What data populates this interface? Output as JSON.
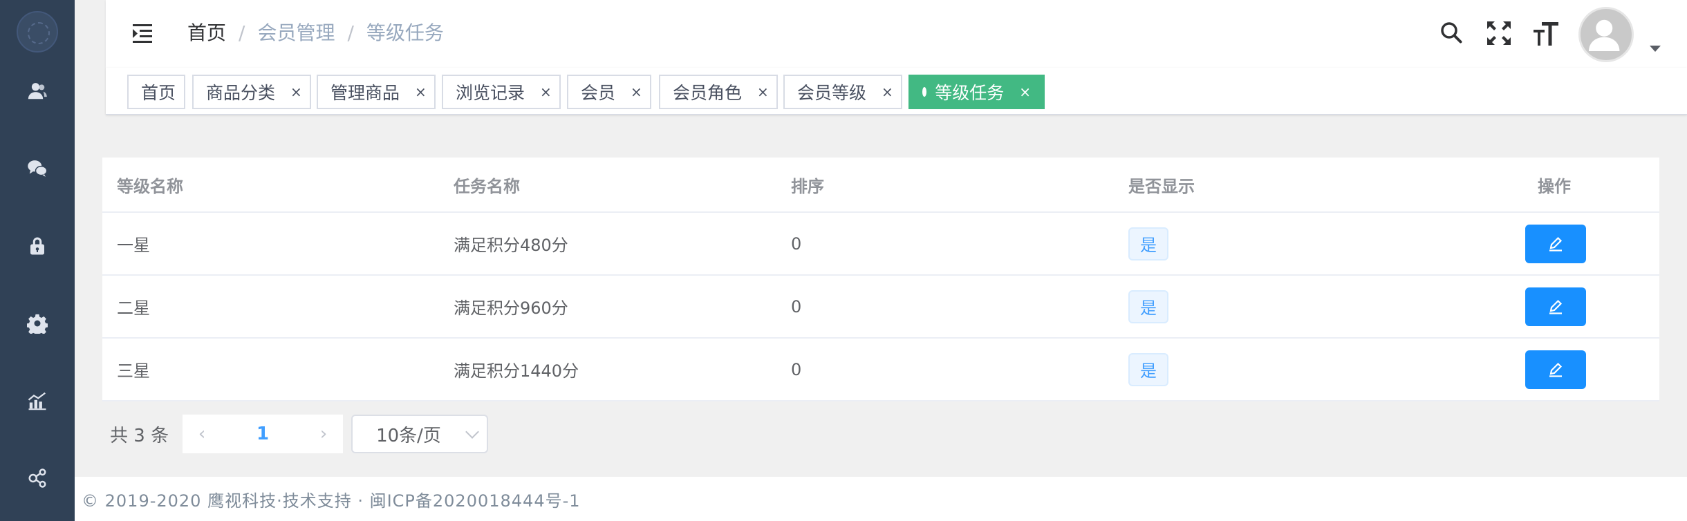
{
  "sidebar": {
    "items": [
      {
        "icon": "users-icon"
      },
      {
        "icon": "wechat-icon"
      },
      {
        "icon": "lock-icon"
      },
      {
        "icon": "gear-icon"
      },
      {
        "icon": "chart-icon"
      },
      {
        "icon": "share-icon"
      }
    ]
  },
  "breadcrumb": [
    "首页",
    "会员管理",
    "等级任务"
  ],
  "breadcrumb_separator": "/",
  "tags": [
    {
      "label": "首页",
      "closable": false
    },
    {
      "label": "商品分类",
      "closable": true
    },
    {
      "label": "管理商品",
      "closable": true
    },
    {
      "label": "浏览记录",
      "closable": true
    },
    {
      "label": "会员",
      "closable": true
    },
    {
      "label": "会员角色",
      "closable": true
    },
    {
      "label": "会员等级",
      "closable": true
    },
    {
      "label": "等级任务",
      "closable": true,
      "active": true
    }
  ],
  "tag_close_glyph": "×",
  "table": {
    "headers": [
      "等级名称",
      "任务名称",
      "排序",
      "是否显示",
      "操作"
    ],
    "rows": [
      {
        "level": "一星",
        "task": "满足积分480分",
        "sort": "0",
        "show": "是"
      },
      {
        "level": "二星",
        "task": "满足积分960分",
        "sort": "0",
        "show": "是"
      },
      {
        "level": "三星",
        "task": "满足积分1440分",
        "sort": "0",
        "show": "是"
      }
    ]
  },
  "pagination": {
    "total_text": "共 3 条",
    "current_page": "1",
    "prev_glyph": "‹",
    "next_glyph": "›",
    "page_size": "10条/页"
  },
  "footer": {
    "text": "© 2019-2020 鹰视科技·技术支持 · 闽ICP备2020018444号-1"
  },
  "colors": {
    "sidebar_bg": "#304156",
    "active_tag": "#42b983",
    "primary": "#1890ff"
  }
}
